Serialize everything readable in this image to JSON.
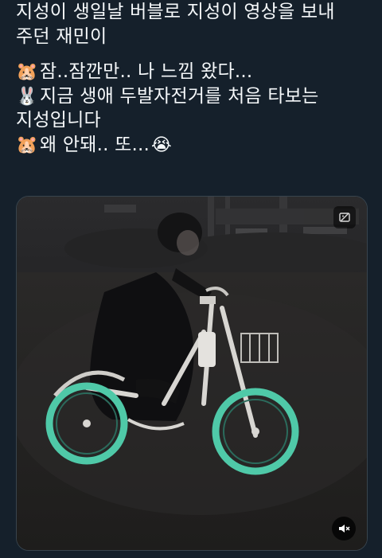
{
  "tweet": {
    "lines": [
      "지성이 생일날 버블로 지성이 영상을 보내",
      "주던 재민이"
    ],
    "chat": [
      {
        "emoji": "🐹",
        "text": "잠..잠깐만.. 나 느낌 왔다..."
      },
      {
        "emoji": "🐰",
        "text": "지금 생애 두발자전거를 처음 타보는"
      },
      {
        "emoji": "",
        "text": "지성입니다"
      },
      {
        "emoji": "🐹",
        "text": "왜 안돼.. 또...",
        "trailing_emoji": "😭"
      }
    ]
  },
  "media": {
    "type": "video",
    "badge_icon": "gif-off-icon",
    "mute_icon": "speaker-muted-icon"
  }
}
